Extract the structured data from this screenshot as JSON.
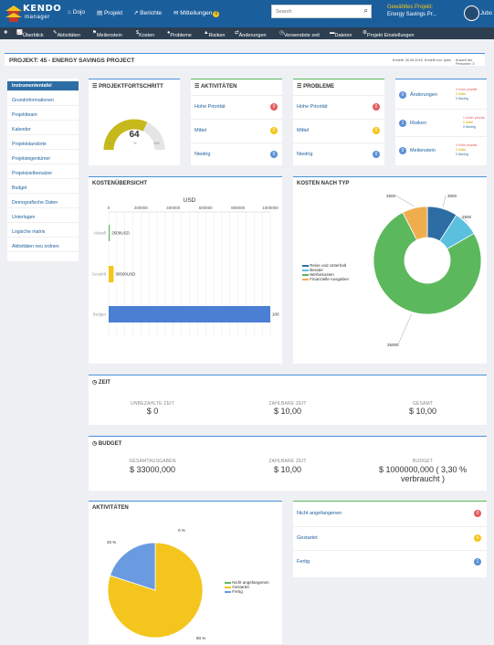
{
  "app": {
    "logo_line1": "KENDO",
    "logo_line2": "manager"
  },
  "topnav": {
    "dojo": "Dojo",
    "projekt": "Projekt",
    "berichte": "Berichte",
    "mitteilungen": "Mitteilungen",
    "mitteilungen_count": "0"
  },
  "search": {
    "placeholder": "Search"
  },
  "project_select": {
    "label": "Gewähltes Projekt:",
    "value": "Energy Savings Pr..."
  },
  "user": {
    "name": "Jubo"
  },
  "subnav": {
    "uberblick": "Überblick",
    "aktivitaten": "Aktivitäten",
    "meilenstein": "Meilenstein",
    "kosten": "Kosten",
    "probleme": "Probleme",
    "risiken": "Risiken",
    "anderungen": "Änderungen",
    "zeit": "Verwendete zeit",
    "dateien": "Dateien",
    "einstellungen": "Projekt Einstellungen"
  },
  "header": {
    "title": "PROJEKT: 45 - ENERGY SAVINGS PROJECT",
    "created": "Erstellt: 30.09.2016",
    "by": "Erstellt von: ljubo",
    "members": "Anzahl der Personen: 3"
  },
  "sidebar": {
    "items": [
      "Instrumententafel",
      "Grundinformationen",
      "Projektteam",
      "Kalender",
      "Projektstandorte",
      "Projekteigentümer",
      "Projektzielbenutzer",
      "Budget",
      "Demografische Daten",
      "Unterlagen",
      "Logische matrix",
      "Aktivitäten neu ordnen"
    ]
  },
  "progress": {
    "title": "PROJEKTFORTSCHRITT",
    "value": "64",
    "percent": 64,
    "min": "0",
    "unit": "%",
    "max": "100"
  },
  "aktivitaten": {
    "title": "AKTIVITÄTEN",
    "rows": [
      {
        "label": "Hohe Priorität",
        "count": "0",
        "color": "#e35b5a"
      },
      {
        "label": "Mittel",
        "count": "0",
        "color": "#f4c51c"
      },
      {
        "label": "Niedrig",
        "count": "0",
        "color": "#5b8fd4"
      }
    ]
  },
  "probleme": {
    "title": "PROBLEME",
    "rows": [
      {
        "label": "Hohe Priorität",
        "count": "0",
        "color": "#e35b5a"
      },
      {
        "label": "Mittel",
        "count": "0",
        "color": "#f4c51c"
      },
      {
        "label": "Niedrig",
        "count": "0",
        "color": "#5b8fd4"
      }
    ]
  },
  "summary": {
    "rows": [
      {
        "count": "0",
        "label": "Änderungen",
        "l1": "0 hohe priorität",
        "l2": "0 Mittel",
        "l3": "0 Niedrig"
      },
      {
        "count": "1",
        "label": "Risiken",
        "l1": "1 hoher prioriat",
        "l2": "0 Mittel",
        "l3": "0 Niedrig"
      },
      {
        "count": "0",
        "label": "Meilenstein",
        "l1": "0 hohe priorität",
        "l2": "0 Mittel",
        "l3": "0 Niedrig"
      }
    ]
  },
  "kosten": {
    "title": "KOSTENÜBERSICHT",
    "axis_title": "USD",
    "ticks": [
      "0",
      "200000",
      "400000",
      "600000",
      "800000",
      "1000000"
    ],
    "rows": [
      {
        "label": "Aktuell",
        "value": 2500,
        "text": "2500USD"
      },
      {
        "label": "Gezahlt",
        "value": 30500,
        "text": "30500USD"
      },
      {
        "label": "Budget",
        "value": 1000000,
        "text": "100"
      }
    ]
  },
  "kosten_typ": {
    "title": "KOSTEN NACH TYP",
    "legend": [
      "Reise und Unterhalt",
      "Berater",
      "Werbekosten",
      "Finanzielle Ausgaben"
    ]
  },
  "zeit": {
    "title": "ZEIT",
    "cols": [
      {
        "label": "UNBEZAHLTE ZEIT",
        "value": "$ 0"
      },
      {
        "label": "ZAHLBARE ZEIT",
        "value": "$ 10,00"
      },
      {
        "label": "GESAMT",
        "value": "$ 10,00"
      }
    ]
  },
  "budget": {
    "title": "BUDGET",
    "cols": [
      {
        "label": "GESAMTAUSGABEN",
        "value": "$ 33000,000"
      },
      {
        "label": "ZAHLBARE ZEIT",
        "value": "$ 10,00"
      },
      {
        "label": "BUDGET",
        "value": "$ 1000000,000 ( 3,30 %",
        "value2": "verbraucht )"
      }
    ]
  },
  "akt_chart": {
    "title": "AKTIVITÄTEN",
    "legend": [
      "Nicht angefangenen",
      "Gestartet",
      "Fertig"
    ],
    "pct_top": "0 %",
    "pct_left": "20 %",
    "pct_bottom": "80 %"
  },
  "akt_status": {
    "rows": [
      {
        "label": "Nicht angefangenen",
        "count": "0",
        "color": "#e35b5a"
      },
      {
        "label": "Gestartet",
        "count": "4",
        "color": "#f4c51c"
      },
      {
        "label": "Fertig",
        "count": "1",
        "color": "#5b8fd4"
      }
    ]
  },
  "chart_data": [
    {
      "type": "bar",
      "title": "KOSTENÜBERSICHT",
      "xlabel": "USD",
      "categories": [
        "Aktuell",
        "Gezahlt",
        "Budget"
      ],
      "values": [
        2500,
        30500,
        1000000
      ],
      "xlim": [
        0,
        1000000
      ]
    },
    {
      "type": "pie",
      "title": "KOSTEN NACH TYP",
      "labels": [
        "Reise und Unterhalt",
        "Berater",
        "Werbekosten",
        "Finanzielle Ausgaben"
      ],
      "values": [
        3000,
        2500,
        25000,
        2500
      ],
      "colors": [
        "#2e6da4",
        "#5bc0de",
        "#5cb85c",
        "#f0ad4e"
      ],
      "donut": true
    },
    {
      "type": "pie",
      "title": "AKTIVITÄTEN",
      "labels": [
        "Nicht angefangenen",
        "Gestartet",
        "Fertig"
      ],
      "values": [
        0,
        80,
        20
      ],
      "colors": [
        "#5cb85c",
        "#f4c51c",
        "#6a9be0"
      ]
    }
  ]
}
